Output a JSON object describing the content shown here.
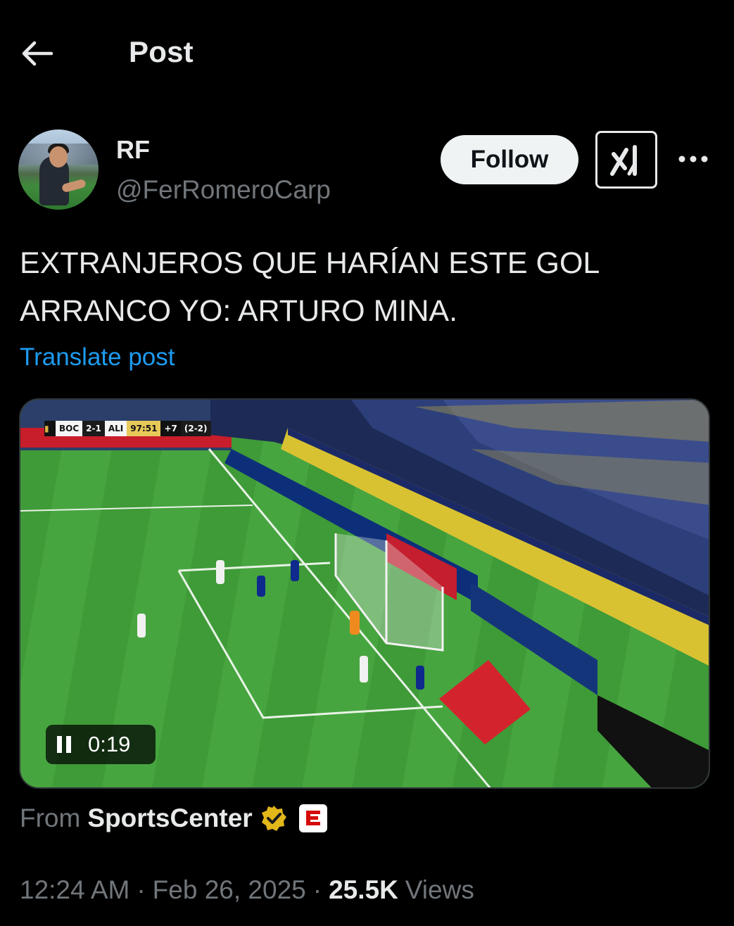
{
  "header": {
    "title": "Post"
  },
  "author": {
    "name": "RF",
    "handle": "@FerRomeroCarp"
  },
  "actions": {
    "follow_label": "Follow"
  },
  "post": {
    "text_lines": [
      "EXTRANJEROS QUE HARÍAN ESTE GOL",
      "ARRANCO YO: ARTURO MINA."
    ],
    "translate_label": "Translate post"
  },
  "video": {
    "scoreboard": {
      "home": "BOC",
      "score": "2-1",
      "away": "ALI",
      "clock": "97:51",
      "added": "+7",
      "aggregate": "(2-2)"
    },
    "time": "0:19"
  },
  "source": {
    "from_label": "From",
    "name": "SportsCenter"
  },
  "meta": {
    "time": "12:24 AM",
    "date": "Feb 26, 2025",
    "views_count": "25.5K",
    "views_label": "Views"
  },
  "colors": {
    "accent": "#1d9bf0",
    "background": "#000000",
    "verified": "#e2b719"
  },
  "icons": [
    "back-arrow-icon",
    "grok-icon",
    "more-icon",
    "pause-icon",
    "verified-icon",
    "espn-icon"
  ]
}
